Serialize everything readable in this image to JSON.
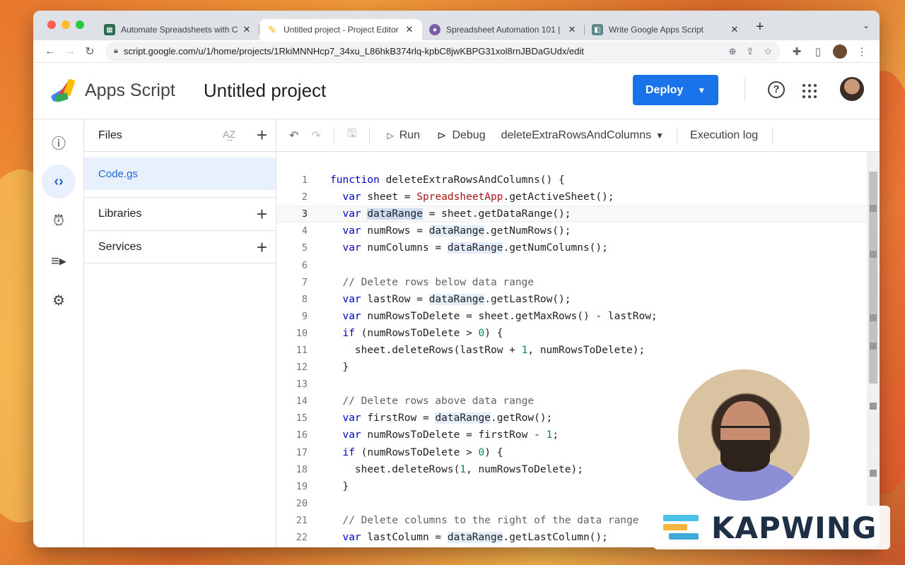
{
  "browser": {
    "tabs": [
      {
        "title": "Automate Spreadsheets with C",
        "favicon_color": "#2d6a4f",
        "active": false
      },
      {
        "title": "Untitled project - Project Editor",
        "favicon_color": "#f4b400",
        "active": true
      },
      {
        "title": "Spreadsheet Automation 101 |",
        "favicon_color": "#7b5ea7",
        "active": false
      },
      {
        "title": "Write Google Apps Script",
        "favicon_color": "#5f8a8b",
        "active": false
      }
    ],
    "close_glyph": "✕",
    "new_tab_glyph": "+",
    "url": "script.google.com/u/1/home/projects/1RkiMNNHcp7_34xu_L86hkB374rlq-kpbC8jwKBPG31xol8rnJBDaGUdx/edit"
  },
  "app": {
    "name": "Apps Script",
    "project_title": "Untitled project",
    "deploy_label": "Deploy",
    "help_glyph": "?"
  },
  "files_panel": {
    "title": "Files",
    "sort_glyph": "A͢Z",
    "active_file": "Code.gs",
    "sections": [
      {
        "label": "Libraries"
      },
      {
        "label": "Services"
      }
    ]
  },
  "editor_toolbar": {
    "run_label": "Run",
    "debug_label": "Debug",
    "function_name": "deleteExtraRowsAndColumns",
    "execution_log_label": "Execution log"
  },
  "code": {
    "current_line": 3,
    "lines": [
      "1",
      "2",
      "3",
      "4",
      "5",
      "6",
      "7",
      "8",
      "9",
      "10",
      "11",
      "12",
      "13",
      "14",
      "15",
      "16",
      "17",
      "18",
      "19",
      "20",
      "21",
      "22"
    ]
  },
  "overlay": {
    "brand": "KAPWING"
  },
  "colors": {
    "accent": "#1a73e8",
    "active_nav_bg": "#e8f0fe",
    "keyword": "#0000c0"
  },
  "icons": {
    "rail": [
      "info-icon",
      "code-icon",
      "alarm-clock-icon",
      "executions-icon",
      "gear-icon"
    ]
  }
}
